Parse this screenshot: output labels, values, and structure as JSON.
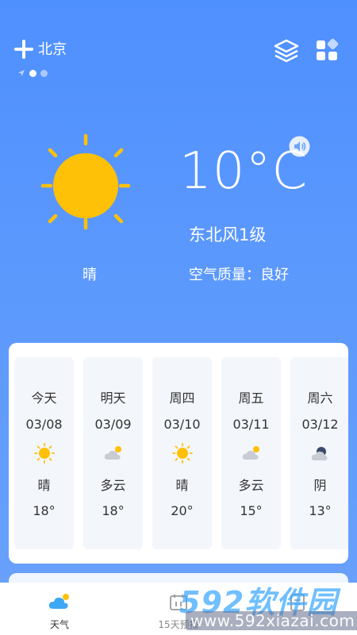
{
  "header": {
    "city": "北京",
    "icons": {
      "add": "plus-icon",
      "location": "location-arrow-icon",
      "layers": "layers-icon",
      "grid": "grid-apps-icon"
    }
  },
  "current": {
    "temperature": "10°C",
    "wind": "东北风1级",
    "condition": "晴",
    "air_quality": "空气质量：良好",
    "icons": {
      "weather": "sun-icon",
      "voice": "speaker-icon"
    }
  },
  "forecast": [
    {
      "day": "今天",
      "date": "03/08",
      "condition": "晴",
      "temp": "18°",
      "icon": "sun-icon"
    },
    {
      "day": "明天",
      "date": "03/09",
      "condition": "多云",
      "temp": "18°",
      "icon": "partly-cloudy-icon"
    },
    {
      "day": "周四",
      "date": "03/10",
      "condition": "晴",
      "temp": "20°",
      "icon": "sun-icon"
    },
    {
      "day": "周五",
      "date": "03/11",
      "condition": "多云",
      "temp": "15°",
      "icon": "partly-cloudy-icon"
    },
    {
      "day": "周六",
      "date": "03/12",
      "condition": "阴",
      "temp": "13°",
      "icon": "overcast-icon"
    }
  ],
  "nav": {
    "weather_label": "天气",
    "fifteen_label": "15天预报"
  },
  "watermark": {
    "brand": "592软件园",
    "url": "www.592xiazai.com"
  },
  "colors": {
    "background": "#4f90ff",
    "sun": "#ffc107",
    "card": "#ffffff",
    "text_dark": "#333333"
  }
}
